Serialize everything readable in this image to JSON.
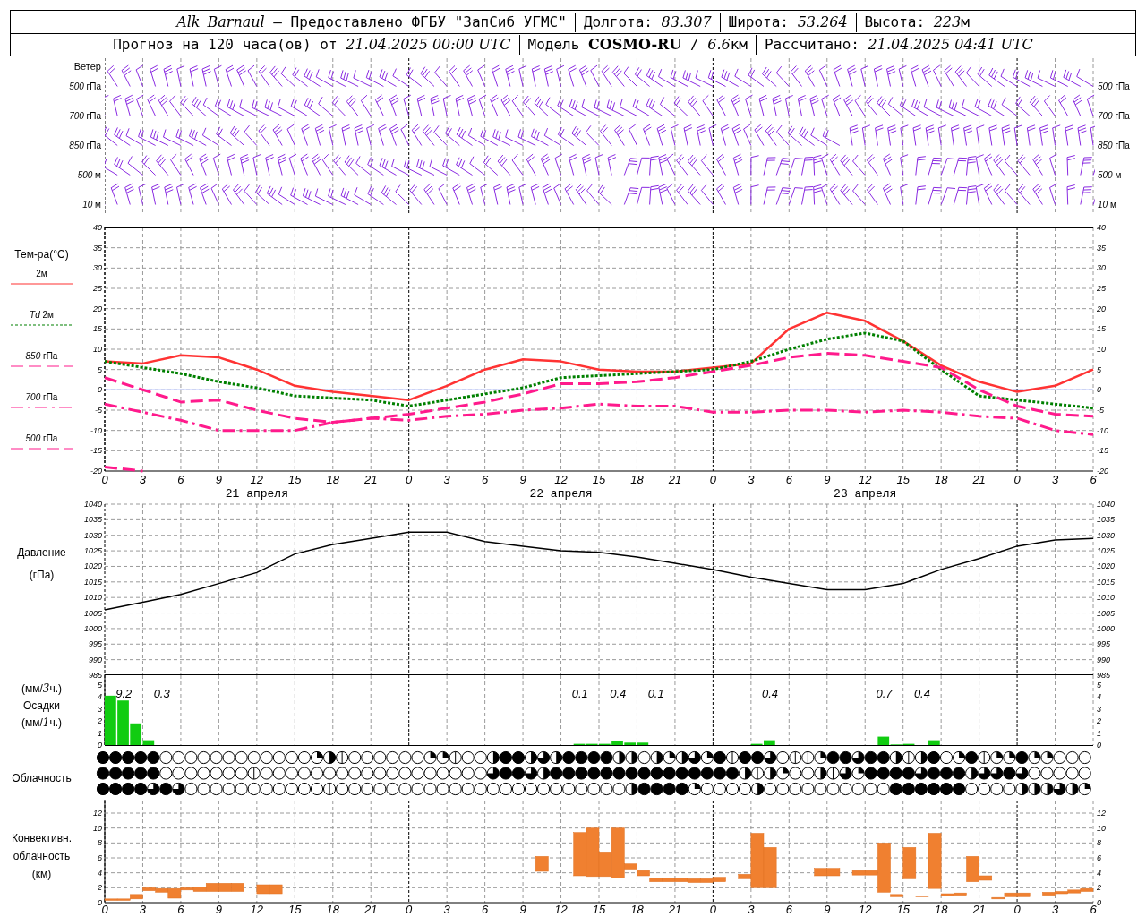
{
  "header": {
    "rows": [
      [
        [
          {
            "text": "Alk_Barnaul",
            "kind": "italic"
          },
          {
            "text": " — Предоставлено ФГБУ \"ЗапСиб УГМС\"",
            "kind": "plain"
          }
        ],
        [
          {
            "text": "Долгота: ",
            "kind": "plain"
          },
          {
            "text": "83.307",
            "kind": "italic"
          }
        ],
        [
          {
            "text": "Широта: ",
            "kind": "plain"
          },
          {
            "text": "53.264",
            "kind": "italic"
          }
        ],
        [
          {
            "text": "Высота: ",
            "kind": "plain"
          },
          {
            "text": "223",
            "kind": "italic"
          },
          {
            "text": "м",
            "kind": "plain"
          }
        ]
      ],
      [
        [
          {
            "text": "Прогноз на 120 часа(ов) от ",
            "kind": "plain"
          },
          {
            "text": "21.04.2025 00:00 UTC",
            "kind": "italic"
          }
        ],
        [
          {
            "text": "Модель ",
            "kind": "plain"
          },
          {
            "text": "COSMO-RU",
            "kind": "bold"
          },
          {
            "text": " / ",
            "kind": "plain"
          },
          {
            "text": "6.6",
            "kind": "italic"
          },
          {
            "text": "км",
            "kind": "plain"
          }
        ],
        [
          {
            "text": "Рассчитано: ",
            "kind": "plain"
          },
          {
            "text": "21.04.2025 04:41 UTC",
            "kind": "italic"
          }
        ]
      ]
    ]
  },
  "wind": {
    "title": "Ветер",
    "levels_left": [
      "*500* гПа",
      "*700* гПа",
      "*850* гПа",
      "*500* м",
      "*10* м"
    ],
    "levels_right": [
      "*500* гПа",
      "*700* гПа",
      "*850* гПа",
      "*500* м",
      "*10* м"
    ]
  },
  "temperature": {
    "title": "Тем-ра(°C)",
    "days": [
      "21 апреля",
      "22 апреля",
      "23 апреля"
    ],
    "right_axis_labels": [
      "40",
      "35",
      "30",
      "25",
      "20",
      "15",
      "10",
      "5",
      "0",
      "-5",
      "-10",
      "-15",
      "-20"
    ],
    "chart_data": {
      "type": "line",
      "categories": [
        "0",
        "3",
        "6",
        "9",
        "12",
        "15",
        "18",
        "21",
        "0",
        "3",
        "6",
        "9",
        "12",
        "15",
        "18",
        "21",
        "0",
        "3",
        "6",
        "9",
        "12",
        "15",
        "18",
        "21",
        "0",
        "3",
        "6"
      ],
      "ylim": [
        -20,
        40
      ],
      "grid": true,
      "yticks": [
        -20,
        -15,
        -10,
        -5,
        0,
        5,
        10,
        15,
        20,
        25,
        30,
        35,
        40
      ],
      "ref_lines": [
        {
          "axis": "y",
          "value": 0,
          "color": "#3355ff"
        }
      ],
      "series": [
        {
          "name": "2м",
          "line_style": "solid",
          "color": "#ff3333",
          "values": [
            7,
            6.5,
            8.5,
            8,
            5,
            1,
            -0.5,
            -1.5,
            -2.5,
            1,
            5,
            7.5,
            7,
            5,
            4.5,
            4.5,
            5.5,
            6.5,
            15,
            19,
            17,
            12,
            6,
            2,
            -0.5,
            1,
            5
          ]
        },
        {
          "name": "*Td* 2м",
          "line_style": "dotted",
          "color": "#008000",
          "values": [
            7,
            5.5,
            4,
            2,
            0.5,
            -1.5,
            -2,
            -2.5,
            -4,
            -2.5,
            -1,
            0.5,
            3,
            3.5,
            4,
            4.5,
            5,
            7,
            10,
            12.5,
            14,
            12,
            5,
            -1.5,
            -2.5,
            -3.5,
            -4.5
          ]
        },
        {
          "name": "*850* гПа",
          "line_style": "dashed",
          "color": "#ff1a8c",
          "values": [
            3,
            0,
            -3,
            -2.5,
            -5,
            -7,
            -8,
            -7,
            -6,
            -4.5,
            -3,
            -1,
            1.5,
            1.5,
            2,
            3,
            4.5,
            6,
            8,
            9,
            8.5,
            7,
            5.5,
            0,
            -4,
            -6,
            -6.5
          ]
        },
        {
          "name": "*700* гПа",
          "line_style": "dashdot",
          "color": "#ff1a8c",
          "values": [
            -3.5,
            -5.5,
            -7.5,
            -10,
            -10,
            -10,
            -8,
            -7,
            -7.5,
            -6.5,
            -6,
            -5,
            -4.5,
            -3.5,
            -4,
            -4,
            -5.5,
            -5.5,
            -5,
            -5,
            -5.5,
            -5,
            -5.5,
            -6.5,
            -7,
            -10,
            -11
          ]
        },
        {
          "name": "*500* гПа",
          "line_style": "dashed",
          "color": "#ff1a8c",
          "values": [
            -19,
            -20,
            null,
            null,
            null,
            null,
            null,
            null,
            null,
            null,
            null,
            null,
            null,
            null,
            null,
            null,
            null,
            null,
            null,
            null,
            null,
            null,
            null,
            null,
            null,
            null,
            null
          ]
        }
      ]
    }
  },
  "pressure": {
    "title": "Давление",
    "unit": "(гПа)",
    "right_axis_labels": [
      "1040",
      "1035",
      "1030",
      "1025",
      "1020",
      "1015",
      "1010",
      "1005",
      "1000",
      "995",
      "990",
      "985"
    ],
    "chart_data": {
      "type": "line",
      "ylim": [
        985,
        1040
      ],
      "grid": true,
      "yticks": [
        985,
        990,
        995,
        1000,
        1005,
        1010,
        1015,
        1020,
        1025,
        1030,
        1035,
        1040
      ],
      "series": [
        {
          "color": "#000000",
          "values": [
            1006,
            1008.5,
            1011,
            1014.5,
            1018,
            1024,
            1027,
            1029,
            1031,
            1031,
            1028,
            1026.5,
            1025,
            1024.5,
            1023,
            1021,
            1019,
            1016.5,
            1014.5,
            1012.5,
            1012.5,
            1014.5,
            1019,
            1022.5,
            1026.5,
            1028.5,
            1029
          ]
        }
      ]
    }
  },
  "precipitation": {
    "unit_top": [
      {
        "text": "(мм/",
        "kind": "plain"
      },
      {
        "text": "3",
        "kind": "italic"
      },
      {
        "text": "ч.)",
        "kind": "plain"
      }
    ],
    "title": "Осадки",
    "unit_bottom": [
      {
        "text": "(мм/",
        "kind": "plain"
      },
      {
        "text": "1",
        "kind": "italic"
      },
      {
        "text": "ч.)",
        "kind": "plain"
      }
    ],
    "right_axis_labels": [
      "5",
      "4",
      "3",
      "2",
      "1",
      "0"
    ],
    "chart_data": {
      "type": "bar",
      "ylim": [
        0,
        5.8
      ],
      "grid": true,
      "yticks": [
        0,
        1,
        2,
        3,
        4,
        5
      ],
      "values": [
        4.1,
        3.7,
        1.8,
        0.4,
        0,
        0,
        0,
        0,
        0,
        0,
        0,
        0,
        0,
        0,
        0,
        0,
        0,
        0,
        0,
        0,
        0,
        0,
        0,
        0,
        0,
        0,
        0,
        0,
        0,
        0,
        0,
        0,
        0,
        0,
        0,
        0,
        0,
        0.1,
        0.1,
        0.1,
        0.3,
        0.2,
        0.2,
        0,
        0,
        0,
        0,
        0,
        0,
        0,
        0,
        0.1,
        0.4,
        0,
        0,
        0,
        0,
        0,
        0,
        0,
        0,
        0.7,
        0.05,
        0.1,
        0,
        0.4,
        0,
        0,
        0,
        0,
        0,
        0,
        0,
        0,
        0,
        0,
        0,
        0
      ],
      "annotations": [
        "9.2",
        "0.3",
        "0.1",
        "0.4",
        "0.1",
        "0.4",
        "0.7",
        "0.4"
      ]
    }
  },
  "clouds": {
    "title": "Облачность",
    "rows": [
      {
        "cells": [
          {
            "kind": "full"
          },
          {
            "kind": "full"
          },
          {
            "kind": "full"
          },
          {
            "kind": "full"
          },
          {
            "kind": "full"
          },
          {
            "kind": "clear"
          },
          {
            "kind": "clear"
          },
          {
            "kind": "clear"
          },
          {
            "kind": "clear"
          },
          {
            "kind": "clear"
          },
          {
            "kind": "clear"
          },
          {
            "kind": "clear"
          },
          {
            "kind": "clear"
          },
          {
            "kind": "clear"
          },
          {
            "kind": "clear"
          },
          {
            "kind": "clear"
          },
          {
            "kind": "clear"
          },
          {
            "kind": "quarter"
          },
          {
            "kind": "half"
          },
          {
            "kind": "line"
          },
          {
            "kind": "clear"
          },
          {
            "kind": "clear"
          },
          {
            "kind": "clear"
          },
          {
            "kind": "clear"
          },
          {
            "kind": "clear"
          },
          {
            "kind": "clear"
          },
          {
            "kind": "quarter"
          },
          {
            "kind": "quarter"
          },
          {
            "kind": "line"
          },
          {
            "kind": "clear"
          },
          {
            "kind": "clear"
          },
          {
            "kind": "half"
          },
          {
            "kind": "full"
          },
          {
            "kind": "full"
          },
          {
            "kind": "half"
          },
          {
            "kind": "most"
          },
          {
            "kind": "half"
          },
          {
            "kind": "full"
          },
          {
            "kind": "full"
          },
          {
            "kind": "full"
          },
          {
            "kind": "full"
          },
          {
            "kind": "half"
          },
          {
            "kind": "half"
          },
          {
            "kind": "clear"
          },
          {
            "kind": "half"
          },
          {
            "kind": "quarter"
          },
          {
            "kind": "half"
          },
          {
            "kind": "most"
          },
          {
            "kind": "quarter"
          },
          {
            "kind": "full"
          },
          {
            "kind": "line"
          },
          {
            "kind": "full"
          },
          {
            "kind": "full"
          },
          {
            "kind": "most"
          },
          {
            "kind": "clear"
          },
          {
            "kind": "line"
          },
          {
            "kind": "line"
          },
          {
            "kind": "quarter"
          },
          {
            "kind": "full"
          },
          {
            "kind": "full"
          },
          {
            "kind": "most"
          },
          {
            "kind": "full"
          },
          {
            "kind": "full"
          },
          {
            "kind": "half"
          },
          {
            "kind": "line"
          },
          {
            "kind": "half"
          },
          {
            "kind": "full"
          },
          {
            "kind": "clear"
          },
          {
            "kind": "quarter"
          },
          {
            "kind": "full"
          },
          {
            "kind": "line"
          },
          {
            "kind": "quarter"
          },
          {
            "kind": "quarter"
          },
          {
            "kind": "full"
          },
          {
            "kind": "quarter"
          },
          {
            "kind": "quarter"
          },
          {
            "kind": "clear"
          },
          {
            "kind": "clear"
          },
          {
            "kind": "clear"
          }
        ]
      },
      {
        "cells": [
          {
            "kind": "full"
          },
          {
            "kind": "full"
          },
          {
            "kind": "full"
          },
          {
            "kind": "full"
          },
          {
            "kind": "full"
          },
          {
            "kind": "clear"
          },
          {
            "kind": "clear"
          },
          {
            "kind": "clear"
          },
          {
            "kind": "clear"
          },
          {
            "kind": "clear"
          },
          {
            "kind": "clear"
          },
          {
            "kind": "clear"
          },
          {
            "kind": "line"
          },
          {
            "kind": "clear"
          },
          {
            "kind": "clear"
          },
          {
            "kind": "clear"
          },
          {
            "kind": "clear"
          },
          {
            "kind": "clear"
          },
          {
            "kind": "clear"
          },
          {
            "kind": "clear"
          },
          {
            "kind": "clear"
          },
          {
            "kind": "clear"
          },
          {
            "kind": "clear"
          },
          {
            "kind": "clear"
          },
          {
            "kind": "clear"
          },
          {
            "kind": "clear"
          },
          {
            "kind": "clear"
          },
          {
            "kind": "clear"
          },
          {
            "kind": "clear"
          },
          {
            "kind": "clear"
          },
          {
            "kind": "clear"
          },
          {
            "kind": "most"
          },
          {
            "kind": "full"
          },
          {
            "kind": "full"
          },
          {
            "kind": "most"
          },
          {
            "kind": "half"
          },
          {
            "kind": "full"
          },
          {
            "kind": "full"
          },
          {
            "kind": "full"
          },
          {
            "kind": "full"
          },
          {
            "kind": "full"
          },
          {
            "kind": "full"
          },
          {
            "kind": "full"
          },
          {
            "kind": "full"
          },
          {
            "kind": "full"
          },
          {
            "kind": "full"
          },
          {
            "kind": "full"
          },
          {
            "kind": "full"
          },
          {
            "kind": "full"
          },
          {
            "kind": "full"
          },
          {
            "kind": "full"
          },
          {
            "kind": "half"
          },
          {
            "kind": "line"
          },
          {
            "kind": "half"
          },
          {
            "kind": "quarter"
          },
          {
            "kind": "clear"
          },
          {
            "kind": "clear"
          },
          {
            "kind": "half"
          },
          {
            "kind": "line"
          },
          {
            "kind": "most"
          },
          {
            "kind": "quarter"
          },
          {
            "kind": "full"
          },
          {
            "kind": "full"
          },
          {
            "kind": "full"
          },
          {
            "kind": "full"
          },
          {
            "kind": "most"
          },
          {
            "kind": "full"
          },
          {
            "kind": "full"
          },
          {
            "kind": "full"
          },
          {
            "kind": "half"
          },
          {
            "kind": "most"
          },
          {
            "kind": "most"
          },
          {
            "kind": "full"
          },
          {
            "kind": "most"
          },
          {
            "kind": "clear"
          },
          {
            "kind": "clear"
          },
          {
            "kind": "clear"
          },
          {
            "kind": "clear"
          },
          {
            "kind": "clear"
          }
        ]
      },
      {
        "cells": [
          {
            "kind": "full"
          },
          {
            "kind": "full"
          },
          {
            "kind": "full"
          },
          {
            "kind": "full"
          },
          {
            "kind": "most"
          },
          {
            "kind": "full"
          },
          {
            "kind": "most"
          },
          {
            "kind": "clear"
          },
          {
            "kind": "clear"
          },
          {
            "kind": "clear"
          },
          {
            "kind": "clear"
          },
          {
            "kind": "clear"
          },
          {
            "kind": "clear"
          },
          {
            "kind": "clear"
          },
          {
            "kind": "clear"
          },
          {
            "kind": "clear"
          },
          {
            "kind": "clear"
          },
          {
            "kind": "clear"
          },
          {
            "kind": "line"
          },
          {
            "kind": "clear"
          },
          {
            "kind": "clear"
          },
          {
            "kind": "clear"
          },
          {
            "kind": "clear"
          },
          {
            "kind": "clear"
          },
          {
            "kind": "clear"
          },
          {
            "kind": "clear"
          },
          {
            "kind": "clear"
          },
          {
            "kind": "clear"
          },
          {
            "kind": "clear"
          },
          {
            "kind": "clear"
          },
          {
            "kind": "clear"
          },
          {
            "kind": "clear"
          },
          {
            "kind": "clear"
          },
          {
            "kind": "clear"
          },
          {
            "kind": "clear"
          },
          {
            "kind": "clear"
          },
          {
            "kind": "clear"
          },
          {
            "kind": "clear"
          },
          {
            "kind": "clear"
          },
          {
            "kind": "clear"
          },
          {
            "kind": "clear"
          },
          {
            "kind": "clear"
          },
          {
            "kind": "half"
          },
          {
            "kind": "full"
          },
          {
            "kind": "full"
          },
          {
            "kind": "full"
          },
          {
            "kind": "full"
          },
          {
            "kind": "quarter"
          },
          {
            "kind": "clear"
          },
          {
            "kind": "clear"
          },
          {
            "kind": "clear"
          },
          {
            "kind": "clear"
          },
          {
            "kind": "half"
          },
          {
            "kind": "clear"
          },
          {
            "kind": "clear"
          },
          {
            "kind": "clear"
          },
          {
            "kind": "clear"
          },
          {
            "kind": "clear"
          },
          {
            "kind": "clear"
          },
          {
            "kind": "clear"
          },
          {
            "kind": "clear"
          },
          {
            "kind": "clear"
          },
          {
            "kind": "clear"
          },
          {
            "kind": "full"
          },
          {
            "kind": "full"
          },
          {
            "kind": "full"
          },
          {
            "kind": "full"
          },
          {
            "kind": "full"
          },
          {
            "kind": "full"
          },
          {
            "kind": "clear"
          },
          {
            "kind": "clear"
          },
          {
            "kind": "clear"
          },
          {
            "kind": "clear"
          },
          {
            "kind": "half"
          },
          {
            "kind": "half"
          },
          {
            "kind": "half"
          },
          {
            "kind": "most"
          },
          {
            "kind": "half"
          },
          {
            "kind": "quarter"
          }
        ]
      }
    ]
  },
  "convective": {
    "title": "Конвективн.",
    "title2": "облачность",
    "unit": "(км)",
    "right_axis_labels": [
      "12",
      "10",
      "8",
      "6",
      "4",
      "2",
      "0"
    ],
    "hour_labels": [
      "0",
      "3",
      "6",
      "9",
      "12",
      "15",
      "18",
      "21",
      "0",
      "3",
      "6",
      "9",
      "12",
      "15",
      "18",
      "21",
      "0",
      "3",
      "6",
      "9",
      "12",
      "15",
      "18",
      "21",
      "0",
      "3",
      "6"
    ],
    "chart_data": {
      "type": "candlestick",
      "ylim": [
        0,
        13.8
      ],
      "grid": true,
      "yticks": [
        0,
        2,
        4,
        6,
        8,
        10,
        12
      ],
      "ohlc": [
        [
          0.3,
          0.5,
          0.3,
          0.5
        ],
        [
          0.3,
          0.5,
          0.3,
          0.5
        ],
        [
          0.5,
          1.1,
          0.5,
          1.1
        ],
        [
          1.6,
          2,
          1.6,
          2
        ],
        [
          1.4,
          1.9,
          1.4,
          1.9
        ],
        [
          0.6,
          1.9,
          0.6,
          1.9
        ],
        [
          1.7,
          2,
          1.7,
          2
        ],
        [
          1.5,
          2.1,
          1.5,
          2.1
        ],
        [
          1.5,
          2.6,
          1.5,
          2.6
        ],
        [
          1.5,
          2.6,
          1.5,
          2.6
        ],
        [
          1.5,
          2.6,
          1.5,
          2.6
        ],
        null,
        [
          1.2,
          2.4,
          1.2,
          2.4
        ],
        [
          1.2,
          2.4,
          1.2,
          2.4
        ],
        null,
        null,
        null,
        null,
        null,
        null,
        null,
        null,
        null,
        null,
        null,
        null,
        null,
        null,
        null,
        null,
        null,
        null,
        null,
        null,
        [
          4.2,
          6.2,
          4.2,
          6.2
        ],
        null,
        null,
        [
          3.6,
          9.4,
          3.6,
          9.4
        ],
        [
          3.5,
          10,
          3.5,
          10
        ],
        [
          3.5,
          6.8,
          3.5,
          6.8
        ],
        [
          3.3,
          10,
          3.3,
          10
        ],
        [
          4.5,
          5.2,
          4.5,
          5.2
        ],
        [
          3.6,
          4.3,
          3.6,
          4.3
        ],
        [
          2.8,
          3.3,
          2.8,
          3.3
        ],
        [
          2.8,
          3.3,
          2.8,
          3.3
        ],
        [
          2.8,
          3.3,
          2.8,
          3.3
        ],
        [
          2.7,
          3.2,
          2.7,
          3.2
        ],
        [
          2.7,
          3.2,
          2.7,
          3.2
        ],
        [
          2.8,
          3.4,
          2.8,
          3.4
        ],
        null,
        [
          3.2,
          3.8,
          3.2,
          3.8
        ],
        [
          2,
          9.3,
          2,
          9.3
        ],
        [
          2,
          7.4,
          2,
          7.4
        ],
        null,
        null,
        null,
        [
          3.6,
          4.6,
          3.6,
          4.6
        ],
        [
          3.6,
          4.6,
          3.6,
          4.6
        ],
        null,
        [
          3.7,
          4.3,
          3.7,
          4.3
        ],
        [
          3.7,
          4.3,
          3.7,
          4.3
        ],
        [
          1.4,
          8,
          1.4,
          8
        ],
        [
          0.8,
          1.1,
          0.8,
          1.1
        ],
        [
          3.2,
          7.4,
          3.2,
          7.4
        ],
        [
          0.8,
          0.9,
          0.8,
          0.9
        ],
        [
          1.9,
          9.3,
          1.9,
          9.3
        ],
        [
          0.9,
          1.2,
          0.9,
          1.2
        ],
        [
          1,
          1.3,
          1,
          1.3
        ],
        [
          2.8,
          6.2,
          2.8,
          6.2
        ],
        [
          3,
          3.6,
          3,
          3.6
        ],
        [
          0.5,
          0.7,
          0.5,
          0.7
        ],
        [
          0.8,
          1.3,
          0.8,
          1.3
        ],
        [
          0.8,
          1.3,
          0.8,
          1.3
        ],
        null,
        [
          1,
          1.4,
          1,
          1.4
        ],
        [
          1.2,
          1.5,
          1.2,
          1.5
        ],
        [
          1.3,
          1.7,
          1.3,
          1.7
        ],
        [
          1.5,
          1.9,
          1.5,
          1.9
        ]
      ]
    }
  }
}
